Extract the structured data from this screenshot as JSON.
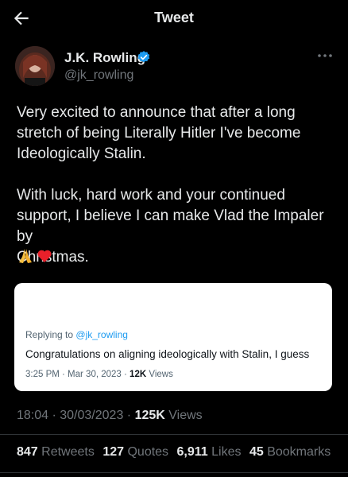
{
  "header": {
    "title": "Tweet"
  },
  "author": {
    "name": "J.K. Rowling",
    "handle": "@jk_rowling"
  },
  "tweet": {
    "paragraph1": "Very excited to announce that after a long\nstretch of being Literally Hitler I've become\nIdeologically Stalin.",
    "paragraph2": "With luck, hard work and your continued\nsupport, I believe I can make Vlad the Impaler by\nChristmas.",
    "emojis": [
      "praying-hands",
      "red-heart"
    ]
  },
  "quote": {
    "replying_label": "Replying to",
    "replying_handle": "@jk_rowling",
    "text": "Congratulations on aligning ideologically with Stalin, I guess",
    "timestamp": "3:25 PM · Mar 30, 2023 · ",
    "views_count": "12K",
    "views_label": "Views"
  },
  "meta": {
    "timestamp": "18:04 · 30/03/2023 · ",
    "views_count": "125K",
    "views_label": "Views"
  },
  "stats": {
    "retweets_count": "847",
    "retweets_label": "Retweets",
    "quotes_count": "127",
    "quotes_label": "Quotes",
    "likes_count": "6,911",
    "likes_label": "Likes",
    "bookmarks_count": "45",
    "bookmarks_label": "Bookmarks"
  },
  "colors": {
    "background": "#000000",
    "text": "#e7e9ea",
    "muted": "#71767b",
    "link": "#1d9bf0",
    "verified": "#1d9bf0"
  }
}
